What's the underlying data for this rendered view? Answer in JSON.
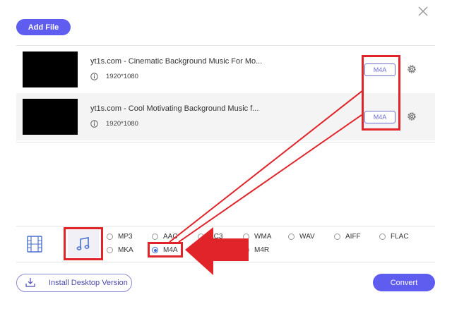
{
  "header": {
    "add_file_label": "Add File"
  },
  "files": [
    {
      "title": "yt1s.com - Cinematic Background Music For Mo...",
      "resolution": "1920*1080",
      "format": "M4A"
    },
    {
      "title": "yt1s.com - Cool Motivating Background Music f...",
      "resolution": "1920*1080",
      "format": "M4A"
    }
  ],
  "formats": {
    "row1": [
      "MP3",
      "AAC",
      "AC3",
      "WMA",
      "WAV",
      "AIFF",
      "FLAC"
    ],
    "row2": [
      "MKA",
      "M4A",
      "M4R"
    ],
    "selected": "M4A"
  },
  "footer": {
    "install_label": "Install Desktop Version",
    "convert_label": "Convert"
  },
  "colors": {
    "accent": "#5f5cf0",
    "annotation": "#e0242a"
  },
  "icons": [
    "close-icon",
    "info-icon",
    "gear-icon",
    "video-icon",
    "music-note-icon",
    "download-icon"
  ]
}
